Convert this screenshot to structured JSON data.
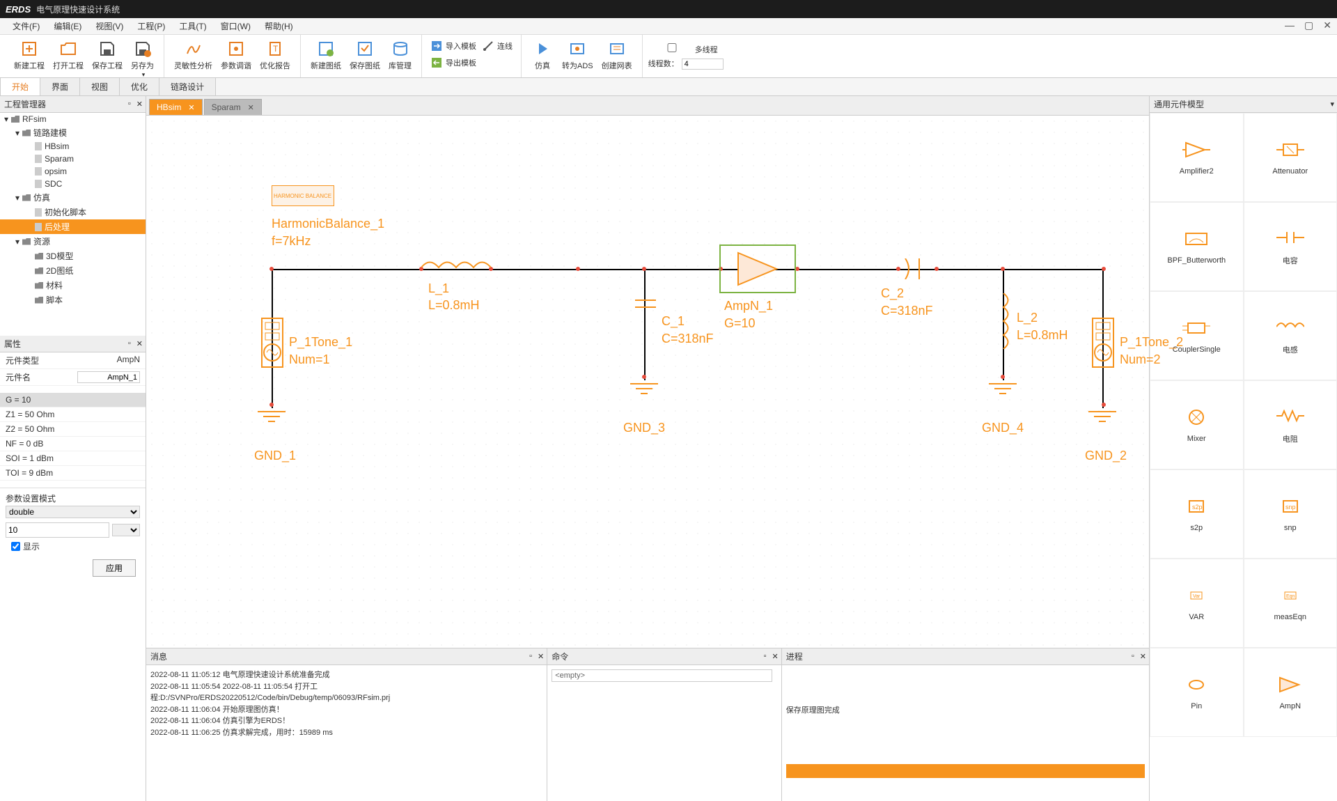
{
  "app": {
    "logo": "ERDS",
    "title": "电气原理快速设计系统"
  },
  "menu": [
    "文件(F)",
    "编辑(E)",
    "视图(V)",
    "工程(P)",
    "工具(T)",
    "窗口(W)",
    "帮助(H)"
  ],
  "toolbar": {
    "g1": [
      "新建工程",
      "打开工程",
      "保存工程",
      "另存为"
    ],
    "g2": [
      "灵敏性分析",
      "参数调谐",
      "优化报告"
    ],
    "g3": [
      "新建图纸",
      "保存图纸",
      "库管理"
    ],
    "g4": [
      "导入模板",
      "导出模板",
      "连线"
    ],
    "g5": [
      "仿真",
      "转为ADS",
      "创建网表"
    ],
    "thread_check": "多线程",
    "thread_label": "线程数：",
    "thread_value": "4"
  },
  "sub_tabs": [
    "开始",
    "界面",
    "视图",
    "优化",
    "链路设计"
  ],
  "project_panel": {
    "title": "工程管理器",
    "tree": [
      {
        "level": 0,
        "caret": "▾",
        "type": "folder",
        "label": "RFsim"
      },
      {
        "level": 1,
        "caret": "▾",
        "type": "folder",
        "label": "链路建模"
      },
      {
        "level": 2,
        "caret": "",
        "type": "file",
        "label": "HBsim"
      },
      {
        "level": 2,
        "caret": "",
        "type": "file",
        "label": "Sparam"
      },
      {
        "level": 2,
        "caret": "",
        "type": "file",
        "label": "opsim"
      },
      {
        "level": 2,
        "caret": "",
        "type": "file",
        "label": "SDC"
      },
      {
        "level": 1,
        "caret": "▾",
        "type": "folder",
        "label": "仿真"
      },
      {
        "level": 2,
        "caret": "",
        "type": "file",
        "label": "初始化脚本"
      },
      {
        "level": 2,
        "caret": "",
        "type": "file",
        "label": "后处理",
        "selected": true
      },
      {
        "level": 1,
        "caret": "▾",
        "type": "folder",
        "label": "资源"
      },
      {
        "level": 2,
        "caret": "",
        "type": "folder",
        "label": "3D模型"
      },
      {
        "level": 2,
        "caret": "",
        "type": "folder",
        "label": "2D图纸"
      },
      {
        "level": 2,
        "caret": "",
        "type": "folder",
        "label": "材料"
      },
      {
        "level": 2,
        "caret": "",
        "type": "folder",
        "label": "脚本"
      }
    ]
  },
  "props_panel": {
    "title": "属性",
    "type_label": "元件类型",
    "type_value": "AmpN",
    "name_label": "元件名",
    "name_value": "AmpN_1",
    "rows": [
      {
        "text": "G = 10",
        "sel": true
      },
      {
        "text": "Z1 = 50 Ohm"
      },
      {
        "text": "Z2 = 50 Ohm"
      },
      {
        "text": "NF = 0 dB"
      },
      {
        "text": "SOI = 1 dBm"
      },
      {
        "text": "TOI = 9 dBm"
      }
    ],
    "param_mode_label": "参数设置模式",
    "param_mode_value": "double",
    "param_num": "10",
    "show_label": "显示",
    "apply": "应用"
  },
  "doc_tabs": [
    {
      "label": "HBsim",
      "active": true
    },
    {
      "label": "Sparam",
      "active": false
    }
  ],
  "schematic": {
    "hb_box": "HARMONIC BALANCE",
    "hb_name": "HarmonicBalance_1",
    "hb_param": "f=7kHz",
    "l1": "L_1",
    "l1_val": "L=0.8mH",
    "c1": "C_1",
    "c1_val": "C=318nF",
    "amp": "AmpN_1",
    "amp_val": "G=10",
    "c2": "C_2",
    "c2_val": "C=318nF",
    "l2": "L_2",
    "l2_val": "L=0.8mH",
    "p1": "P_1Tone_1",
    "p1_val": "Num=1",
    "p2": "P_1Tone_2",
    "p2_val": "Num=2",
    "gnd1": "GND_1",
    "gnd2": "GND_2",
    "gnd3": "GND_3",
    "gnd4": "GND_4"
  },
  "bottom": {
    "msg_title": "消息",
    "cmd_title": "命令",
    "proc_title": "进程",
    "messages": [
      "2022-08-11 11:05:12 电气原理快速设计系统准备完成",
      "2022-08-11 11:05:54 2022-08-11 11:05:54 打开工程:D:/SVNPro/ERDS20220512/Code/bin/Debug/temp/06093/RFsim.prj",
      "2022-08-11 11:06:04 开始原理图仿真！",
      "2022-08-11 11:06:04 仿真引擎为ERDS！",
      "2022-08-11 11:06:25 仿真求解完成，用时：15989 ms"
    ],
    "cmd_placeholder": "<empty>",
    "proc_text": "保存原理图完成"
  },
  "right_panel": {
    "title": "通用元件模型",
    "items": [
      "Amplifier2",
      "Attenuator",
      "BPF_Butterworth",
      "电容",
      "CouplerSingle",
      "电感",
      "Mixer",
      "电阻",
      "s2p",
      "snp",
      "VAR",
      "measEqn",
      "Pin",
      "AmpN"
    ]
  }
}
